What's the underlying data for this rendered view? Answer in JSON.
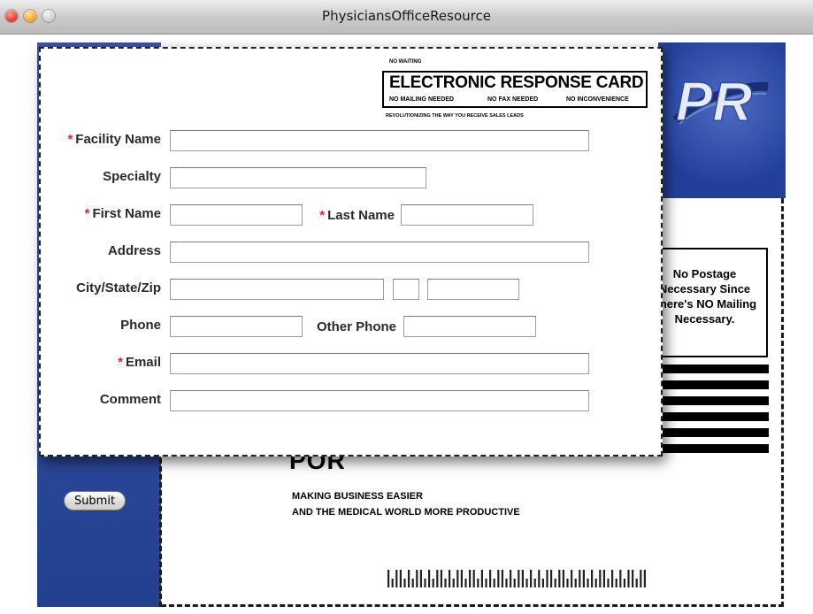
{
  "window": {
    "title": "PhysiciansOfficeResource"
  },
  "card": {
    "logo_text": "PR",
    "postage": [
      "No Postage",
      "Necessary Since",
      "There's NO Mailing",
      "Necessary."
    ],
    "brand": "POR",
    "tagline_1": "MAKING BUSINESS EASIER",
    "tagline_2": "AND THE MEDICAL WORLD MORE PRODUCTIVE",
    "submit_label": "Submit"
  },
  "header": {
    "no_waiting": "NO WAITING",
    "title": "ELECTRONIC RESPONSE CARD",
    "tag1": "NO MAILING NEEDED",
    "tag2": "NO FAX NEEDED",
    "tag3": "NO INCONVENIENCE",
    "subtitle": "REVOLUTIONIZING THE WAY YOU RECEIVE SALES LEADS"
  },
  "form": {
    "required_mark": "*",
    "facility_name": {
      "label": "Facility Name",
      "value": ""
    },
    "specialty": {
      "label": "Specialty",
      "value": ""
    },
    "first_name": {
      "label": "First Name",
      "value": ""
    },
    "last_name": {
      "label": "Last Name",
      "value": ""
    },
    "address": {
      "label": "Address",
      "value": ""
    },
    "city_state_zip": {
      "label": "City/State/Zip",
      "city": "",
      "state": "",
      "zip": ""
    },
    "phone": {
      "label": "Phone",
      "value": ""
    },
    "other_phone": {
      "label": "Other Phone",
      "value": ""
    },
    "email": {
      "label": "Email",
      "value": ""
    },
    "comment": {
      "label": "Comment",
      "value": ""
    }
  },
  "colors": {
    "brand_blue": "#2a46a0",
    "required_red": "#d42a2a"
  }
}
